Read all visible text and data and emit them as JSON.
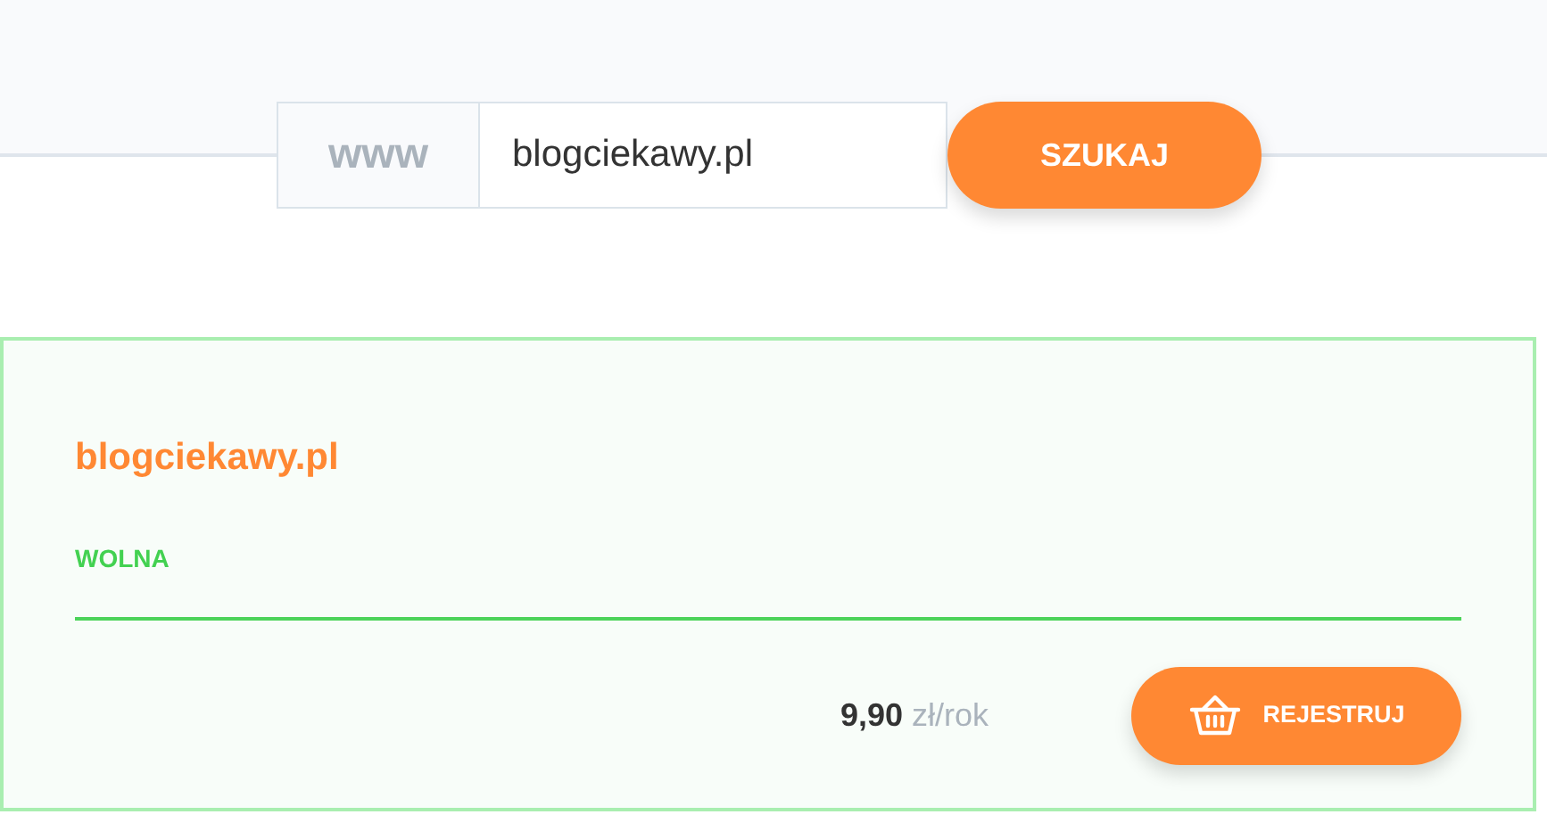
{
  "search": {
    "prefix": "www",
    "value": "blogciekawy.pl",
    "button": "SZUKAJ"
  },
  "result": {
    "domain": "blogciekawy.pl",
    "status": "WOLNA",
    "available": true,
    "price": "9,90",
    "unit": "zł/rok",
    "button": "REJESTRUJ"
  }
}
